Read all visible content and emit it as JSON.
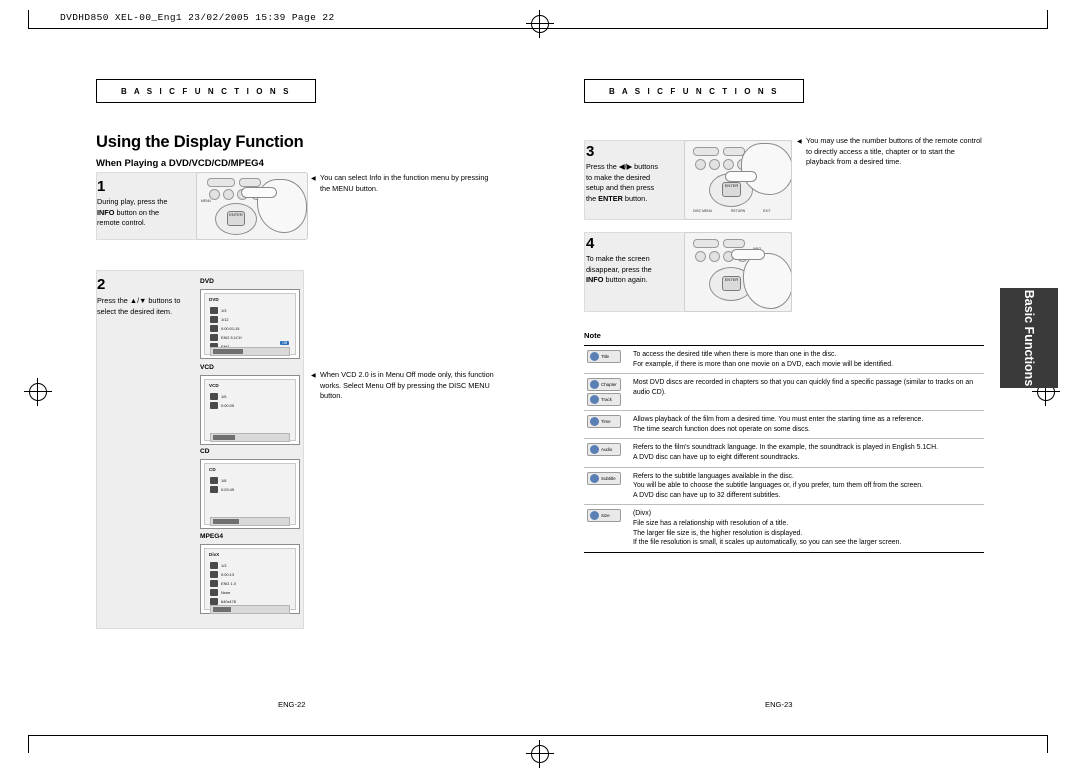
{
  "document": {
    "file_header": "DVDHD850 XEL-00_Eng1   23/02/2005   15:39   Page 22",
    "side_tab": "Basic Functions"
  },
  "left_page": {
    "section_label": "B A S I C   F U N C T I O N S",
    "title": "Using the Display Function",
    "subtitle": "When Playing a DVD/VCD/CD/MPEG4",
    "steps": [
      {
        "number": "1",
        "text_parts": [
          "During play, press the ",
          "INFO",
          " button on the remote control."
        ]
      },
      {
        "number": "2",
        "text": "Press the ▲/▼ buttons to select the desired item."
      }
    ],
    "bullets": [
      "You can select Info in the function menu by pressing the MENU button.",
      "When VCD 2.0 is in Menu Off mode only, this function works. Select Menu Off by pressing the DISC MENU button."
    ],
    "osd_screens": [
      {
        "label": "DVD",
        "title": "DVD",
        "rows": [
          "1/3",
          "1/12",
          "0:00:01:15",
          "ENG 5.1CH",
          "ENG"
        ],
        "chip": "Off"
      },
      {
        "label": "VCD",
        "title": "VCD",
        "rows": [
          "1/5",
          "0:00:05"
        ],
        "chip": ""
      },
      {
        "label": "CD",
        "title": "CD",
        "rows": [
          "1/8",
          "0:03:45"
        ],
        "chip": ""
      },
      {
        "label": "MPEG4",
        "title": "DivX",
        "rows": [
          "1/3",
          "0:00:13",
          "ENG 1.0",
          "None",
          "640x478"
        ],
        "chip": ""
      }
    ]
  },
  "right_page": {
    "section_label": "B A S I C   F U N C T I O N S",
    "steps": [
      {
        "number": "3",
        "text_parts": [
          "Press the ◀/▶ buttons to make the desired setup and then press the ",
          "ENTER",
          " button."
        ]
      },
      {
        "number": "4",
        "text_parts": [
          "To make the screen disappear, press the ",
          "INFO",
          " button again."
        ]
      }
    ],
    "bullets": [
      "You may use the number buttons of the remote control to directly access a title, chapter or to start the playback from a desired time."
    ],
    "note_heading": "Note",
    "note_rows": [
      {
        "icons": [
          {
            "name": "Title"
          }
        ],
        "lines": [
          "To access the desired title when there is more than one in the disc.",
          "For example, if there is more than one movie on a DVD, each movie will be identified."
        ]
      },
      {
        "icons": [
          {
            "name": "Chapter"
          },
          {
            "name": "Track"
          }
        ],
        "lines": [
          "Most DVD discs are recorded in chapters so that you can quickly find a specific passage (similar to tracks on an audio CD)."
        ]
      },
      {
        "icons": [
          {
            "name": "Time"
          }
        ],
        "lines": [
          "Allows playback of the film from a desired time. You must enter the starting time as a reference.",
          "The time search function does not operate on some discs."
        ]
      },
      {
        "icons": [
          {
            "name": "Audio"
          }
        ],
        "lines": [
          "Refers to the film's soundtrack language. In the example, the soundtrack is played in English 5.1CH.",
          "A DVD disc can have up to eight different soundtracks."
        ]
      },
      {
        "icons": [
          {
            "name": "Subtitle"
          }
        ],
        "lines": [
          "Refers to the subtitle languages available in the disc.",
          "You will be able to choose the subtitle languages or, if you prefer, turn them off from the screen.",
          "A DVD disc can have up to 32 different subtitles."
        ]
      },
      {
        "icons": [
          {
            "name": "Size"
          }
        ],
        "lines": [
          "(Divx)",
          "File size has a relationship with resolution of a title.",
          "The larger file size is, the higher resolution is displayed.",
          "If the file resolution is small, it scales up automatically, so you can see the larger screen."
        ]
      }
    ]
  },
  "footer": {
    "left_page_number": "ENG-22",
    "right_page_number": "ENG-23"
  },
  "remote_labels": {
    "enter": "ENTER",
    "small": [
      "MENU",
      "INFO",
      "RETURN",
      "EXIT",
      "DISC MENU"
    ]
  }
}
